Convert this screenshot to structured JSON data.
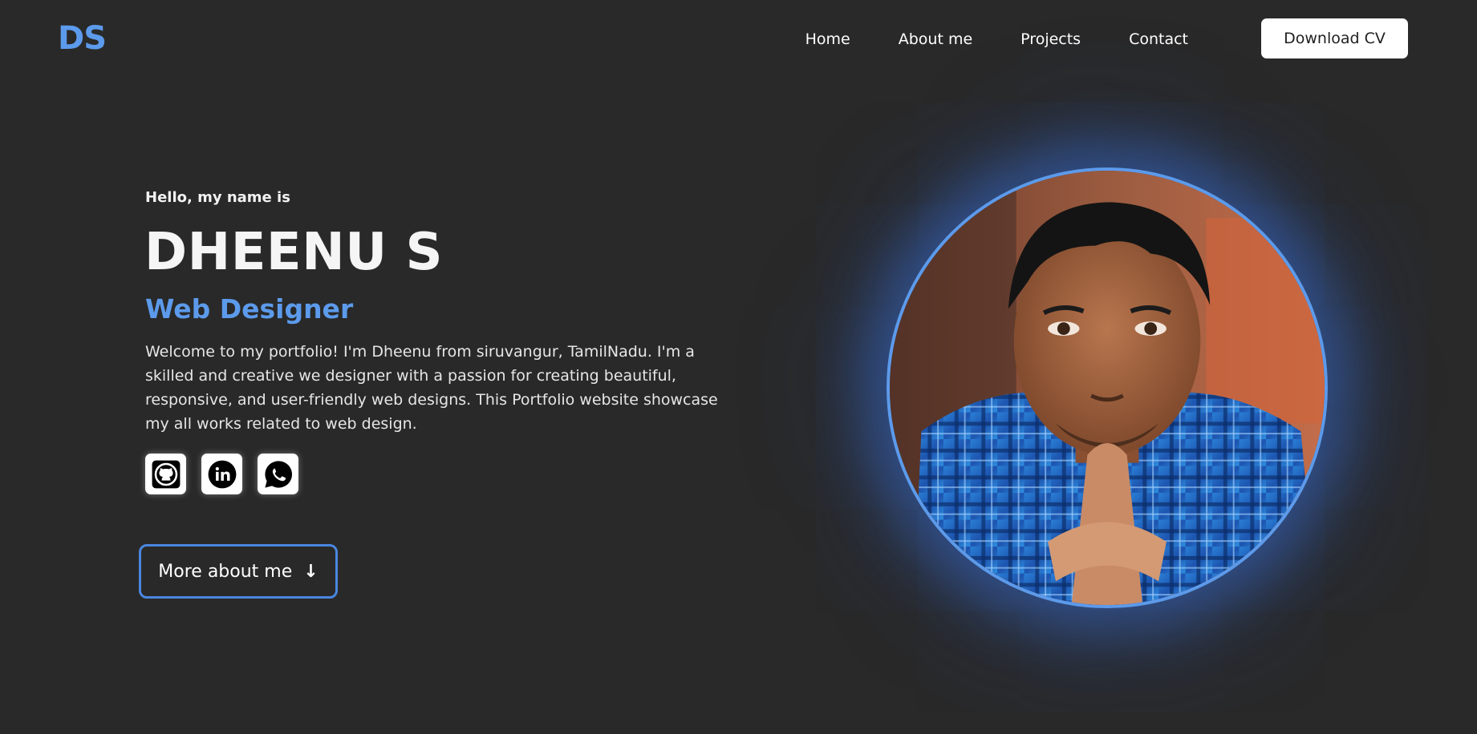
{
  "header": {
    "logo": "DS",
    "nav": [
      "Home",
      "About me",
      "Projects",
      "Contact"
    ],
    "cta": "Download CV"
  },
  "hero": {
    "greeting": "Hello, my name is",
    "name": "DHEENU S",
    "role": "Web Designer",
    "intro": "Welcome to my portfolio! I'm Dheenu from siruvangur, TamilNadu. I'm a skilled and creative we designer with a passion for creating beautiful, responsive, and user-friendly web designs. This Portfolio website showcase my all works related to web design.",
    "socials": [
      "github-icon",
      "linkedin-icon",
      "whatsapp-icon"
    ],
    "more_button": "More about me",
    "more_icon": "arrow-down-icon"
  },
  "colors": {
    "background": "#292929",
    "accent": "#5c9aeb",
    "button_border": "#4a86e0"
  }
}
